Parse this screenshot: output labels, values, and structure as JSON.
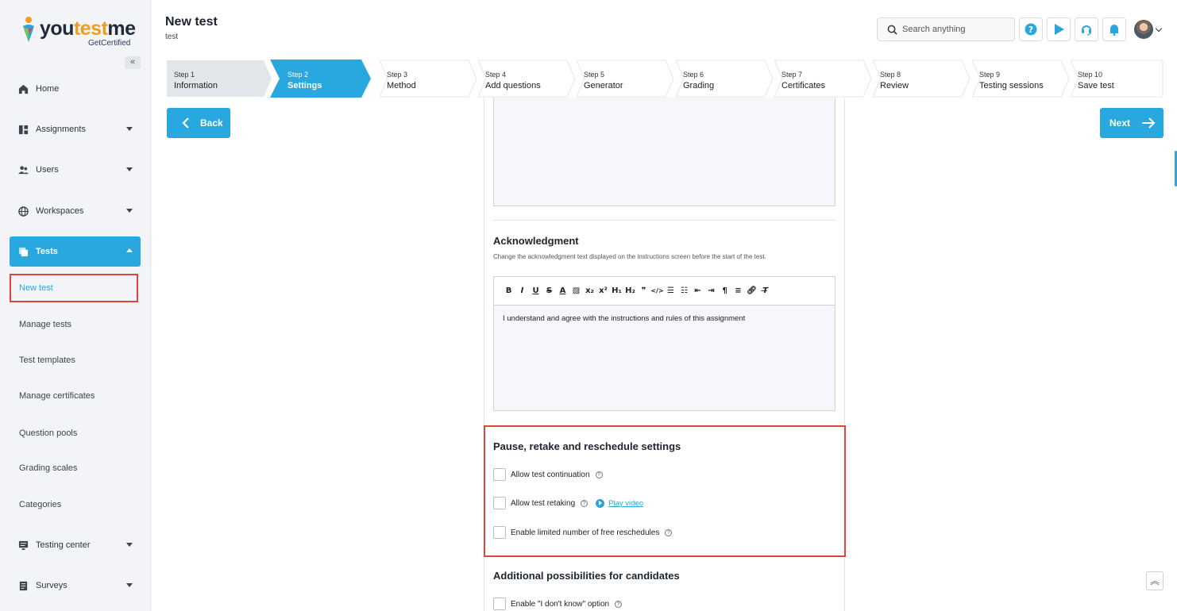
{
  "logo": {
    "brand_a": "you",
    "brand_b": "test",
    "brand_c": "me",
    "tagline": "GetCertified"
  },
  "sidebar": {
    "collapse_glyph": "«",
    "items": [
      {
        "label": "Home",
        "icon": "home-icon"
      },
      {
        "label": "Assignments",
        "icon": "assignments-icon"
      },
      {
        "label": "Users",
        "icon": "users-icon"
      },
      {
        "label": "Workspaces",
        "icon": "globe-icon"
      },
      {
        "label": "Tests",
        "icon": "tests-icon"
      }
    ],
    "sub_items": [
      {
        "label": "New test"
      },
      {
        "label": "Manage tests"
      },
      {
        "label": "Test templates"
      },
      {
        "label": "Manage certificates"
      },
      {
        "label": "Question pools"
      },
      {
        "label": "Grading scales"
      },
      {
        "label": "Categories"
      }
    ],
    "bottom_items": [
      {
        "label": "Testing center",
        "icon": "monitor-icon"
      },
      {
        "label": "Surveys",
        "icon": "survey-icon"
      }
    ]
  },
  "header": {
    "title": "New test",
    "subtitle": "test",
    "search_placeholder": "Search anything"
  },
  "stepper": [
    {
      "num": "Step 1",
      "label": "Information",
      "state": "done"
    },
    {
      "num": "Step 2",
      "label": "Settings",
      "state": "active"
    },
    {
      "num": "Step 3",
      "label": "Method",
      "state": "todo"
    },
    {
      "num": "Step 4",
      "label": "Add questions",
      "state": "todo"
    },
    {
      "num": "Step 5",
      "label": "Generator",
      "state": "todo"
    },
    {
      "num": "Step 6",
      "label": "Grading",
      "state": "todo"
    },
    {
      "num": "Step 7",
      "label": "Certificates",
      "state": "todo"
    },
    {
      "num": "Step 8",
      "label": "Review",
      "state": "todo"
    },
    {
      "num": "Step 9",
      "label": "Testing sessions",
      "state": "todo"
    },
    {
      "num": "Step 10",
      "label": "Save test",
      "state": "todo"
    }
  ],
  "nav": {
    "back_label": "Back",
    "next_label": "Next"
  },
  "acknowledgment": {
    "title": "Acknowledgment",
    "description": "Change the acknowledgment text displayed on the instructions screen before the start of the test.",
    "text": "I understand and agree with the instructions and rules of this assignment"
  },
  "pause_section": {
    "title": "Pause, retake and reschedule settings",
    "options": [
      {
        "label": "Allow test continuation"
      },
      {
        "label": "Allow test retaking",
        "link": "Play video"
      },
      {
        "label": "Enable limited number of free reschedules"
      }
    ]
  },
  "additional_section": {
    "title": "Additional possibilities for candidates",
    "options": [
      {
        "label": "Enable \"I don't know\" option"
      }
    ]
  },
  "colors": {
    "accent": "#29a8e0",
    "highlight": "#e0453c",
    "brand_orange": "#f29c1f"
  }
}
